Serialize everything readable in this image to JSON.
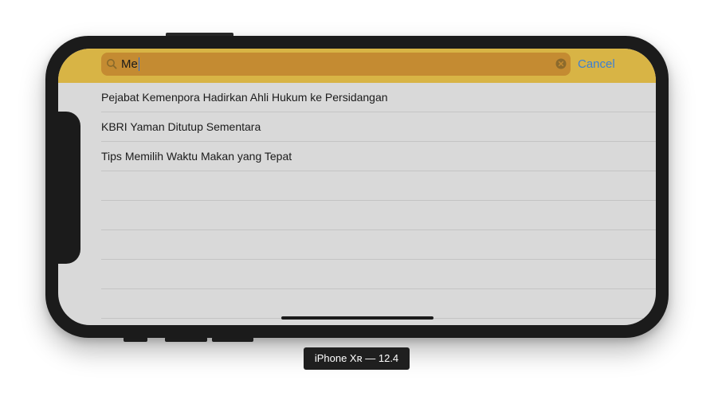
{
  "search": {
    "query": "Me",
    "cancel_label": "Cancel"
  },
  "results": [
    "Pejabat Kemenpora Hadirkan Ahli Hukum ke Persidangan",
    "KBRI Yaman Ditutup Sementara",
    "Tips Memilih Waktu Makan yang Tepat",
    "",
    "",
    "",
    "",
    ""
  ],
  "device_caption": "iPhone Xʀ — 12.4",
  "colors": {
    "searchbar_bg": "#d8b445",
    "search_field_bg": "#c48b32",
    "cancel_text": "#3a7fd6",
    "list_bg": "#d9d9d9"
  },
  "icons": {
    "search": "search-icon",
    "clear": "clear-icon"
  }
}
